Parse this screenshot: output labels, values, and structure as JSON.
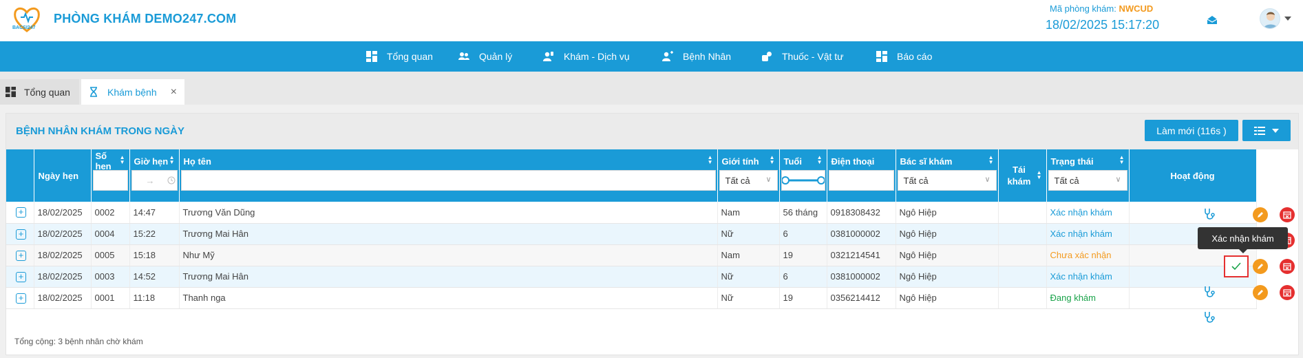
{
  "header": {
    "logo_text": "BACSI247",
    "clinic_name": "PHÒNG KHÁM DEMO247.COM",
    "clinic_code_label": "Mã phòng khám:",
    "clinic_code": "NWCUD",
    "datetime": "18/02/2025 15:17:20"
  },
  "menu": [
    {
      "label": "Tổng quan",
      "icon": "dashboard-icon"
    },
    {
      "label": "Quản lý",
      "icon": "users-icon"
    },
    {
      "label": "Khám - Dịch vụ",
      "icon": "user-service-icon"
    },
    {
      "label": "Bệnh Nhân",
      "icon": "patient-icon"
    },
    {
      "label": "Thuốc - Vật tư",
      "icon": "medicine-icon"
    },
    {
      "label": "Báo cáo",
      "icon": "report-icon"
    }
  ],
  "tabs": [
    {
      "label": "Tổng quan",
      "icon": "dashboard-icon"
    },
    {
      "label": "Khám bệnh",
      "icon": "hourglass-icon",
      "close": "×"
    }
  ],
  "panel": {
    "title": "BỆNH NHÂN KHÁM TRONG NGÀY",
    "refresh_label": "Làm mới (116s )"
  },
  "table": {
    "columns": {
      "date": "Ngày hẹn",
      "num": "Số hẹn",
      "time": "Giờ hẹn",
      "name": "Họ tên",
      "gender": "Giới tính",
      "age": "Tuổi",
      "phone": "Điện thoại",
      "doctor": "Bác sĩ khám",
      "rexam": "Tái khám",
      "status": "Trạng thái",
      "action": "Hoạt động"
    },
    "filters": {
      "gender": "Tất cả",
      "doctor": "Tất cả",
      "status": "Tất cả",
      "time_arrow": "→"
    },
    "rows": [
      {
        "date": "18/02/2025",
        "num": "0002",
        "time": "14:47",
        "name": "Trương Văn Dũng",
        "gender": "Nam",
        "age": "56 tháng",
        "phone": "0918308432",
        "doctor": "Ngô Hiệp",
        "rexam": "",
        "status": "Xác nhận khám"
      },
      {
        "date": "18/02/2025",
        "num": "0004",
        "time": "15:22",
        "name": "Trương Mai Hân",
        "gender": "Nữ",
        "age": "6",
        "phone": "0381000002",
        "doctor": "Ngô Hiệp",
        "rexam": "",
        "status": "Xác nhận khám"
      },
      {
        "date": "18/02/2025",
        "num": "0005",
        "time": "15:18",
        "name": "Như Mỹ",
        "gender": "Nam",
        "age": "19",
        "phone": "0321214541",
        "doctor": "Ngô Hiệp",
        "rexam": "",
        "status": "Chưa xác nhận"
      },
      {
        "date": "18/02/2025",
        "num": "0003",
        "time": "14:52",
        "name": "Trương Mai Hân",
        "gender": "Nữ",
        "age": "6",
        "phone": "0381000002",
        "doctor": "Ngô Hiệp",
        "rexam": "",
        "status": "Xác nhận khám"
      },
      {
        "date": "18/02/2025",
        "num": "0001",
        "time": "11:18",
        "name": "Thanh nga",
        "gender": "Nữ",
        "age": "19",
        "phone": "0356214412",
        "doctor": "Ngô Hiệp",
        "rexam": "",
        "status": "Đang khám"
      }
    ]
  },
  "footer": {
    "total_label": "Tổng cộng:",
    "total_count": "3",
    "total_suffix": "bệnh nhân chờ khám"
  },
  "tooltip": "Xác nhận khám",
  "colors": {
    "brand": "#1a9bd7",
    "accent": "#f39a1e",
    "danger": "#e52f2f",
    "success": "#1aa34a"
  }
}
